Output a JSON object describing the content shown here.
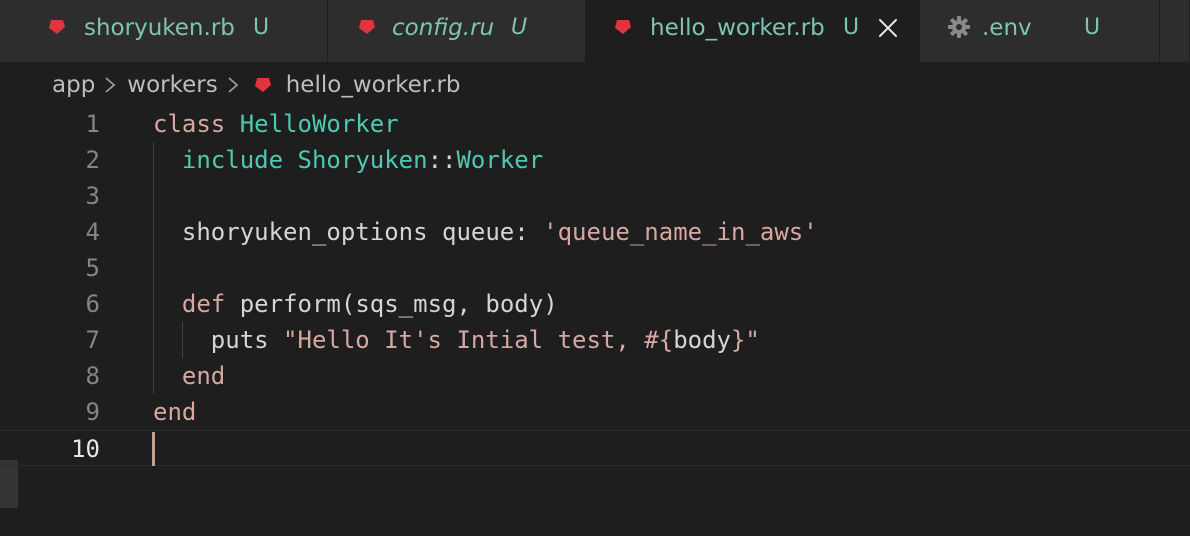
{
  "tabs": [
    {
      "label": "shoryuken.rb",
      "badge": "U",
      "icon": "ruby-icon",
      "active": false
    },
    {
      "label": "config.ru",
      "badge": "U",
      "icon": "ruby-icon",
      "active": false
    },
    {
      "label": "hello_worker.rb",
      "badge": "U",
      "icon": "ruby-icon",
      "active": true
    },
    {
      "label": ".env",
      "badge": "U",
      "icon": "gear-icon",
      "active": false
    }
  ],
  "breadcrumb": {
    "segments": [
      "app",
      "workers",
      "hello_worker.rb"
    ],
    "separator_icon": "chevron-right-icon"
  },
  "editor": {
    "line_numbers": [
      "1",
      "2",
      "3",
      "4",
      "5",
      "6",
      "7",
      "8",
      "9",
      "10"
    ],
    "current_line": "10",
    "tokens": {
      "l1_kw": "class",
      "l1_name": "HelloWorker",
      "l2_kw": "include",
      "l2_mod": "Shoryuken",
      "l2_sep": "::",
      "l2_cls": "Worker",
      "l4_method": "shoryuken_options",
      "l4_key": "queue:",
      "l4_str": "'queue_name_in_aws'",
      "l6_kw": "def",
      "l6_method": "perform",
      "l6_open": "(",
      "l6_arg1": "sqs_msg",
      "l6_comma": ",",
      "l6_arg2": "body",
      "l6_close": ")",
      "l7_method": "puts",
      "l7_str": "\"Hello It's Intial test, #{",
      "l7_interp": "body",
      "l7_str_end": "}\"",
      "l8_kw": "end",
      "l9_kw": "end"
    }
  },
  "colors": {
    "tab_text": "#7ec4b4",
    "ruby": "#e0343f",
    "keyword": "#d7a7a1",
    "class_name": "#4ec9b0",
    "string": "#d7a7a1",
    "background": "#1e1e1e"
  }
}
